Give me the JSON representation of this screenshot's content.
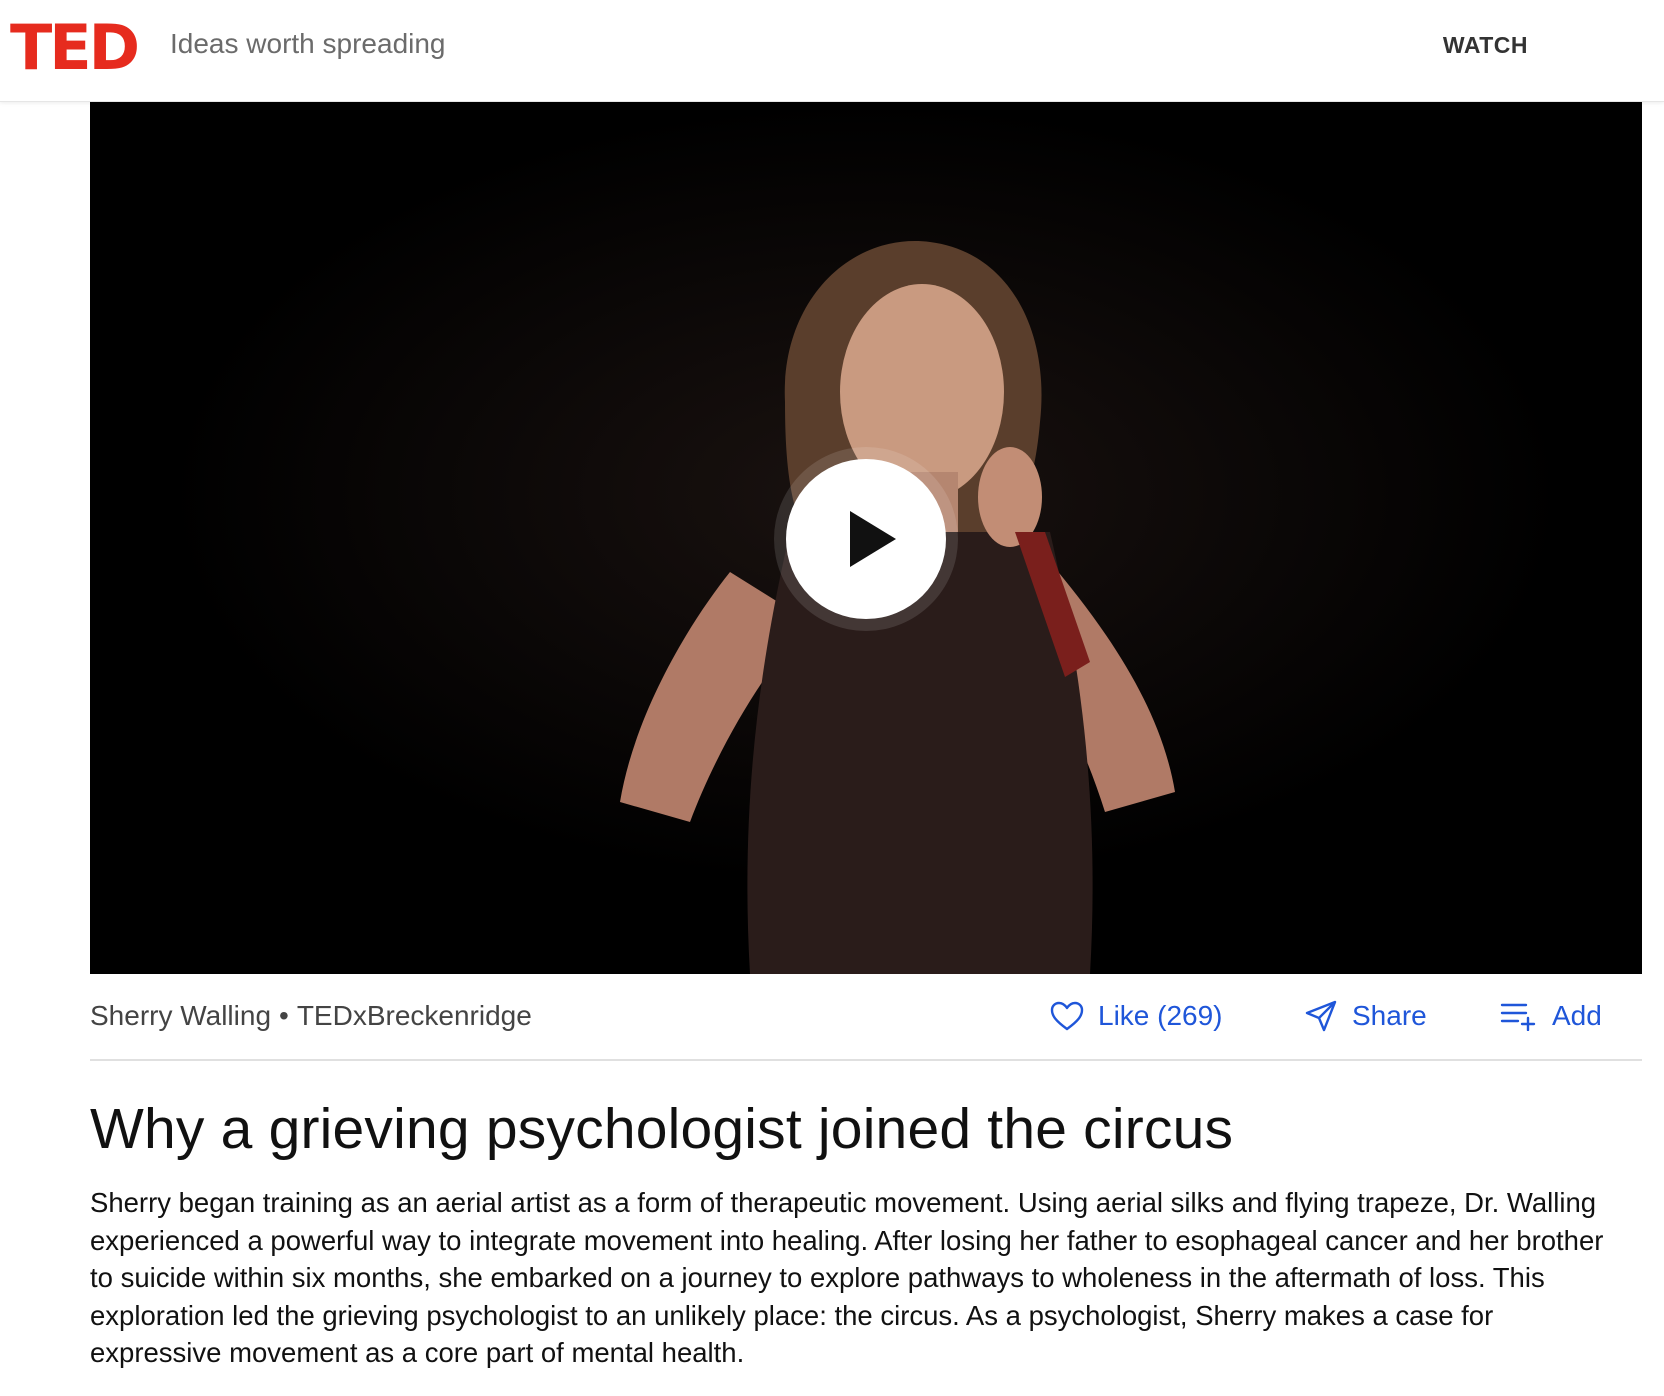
{
  "header": {
    "logo_text": "TED",
    "tagline": "Ideas worth spreading",
    "nav_watch": "WATCH"
  },
  "video": {
    "play_icon": "play-icon"
  },
  "talk": {
    "speaker": "Sherry Walling",
    "separator": "•",
    "event": "TEDxBreckenridge",
    "title": "Why a grieving psychologist joined the circus",
    "description": "Sherry began training as an aerial artist as a form of therapeutic movement. Using aerial silks and flying trapeze, Dr. Walling experienced a powerful way to integrate movement into healing. After losing her father to esophageal cancer and her brother to suicide within six months, she embarked on a journey to explore pathways to wholeness in the aftermath of loss. This exploration led the grieving psychologist to an unlikely place: the circus. As a psychologist, Sherry makes a case for expressive movement as a core part of mental health."
  },
  "actions": {
    "like_label": "Like (269)",
    "share_label": "Share",
    "add_label": "Add"
  },
  "colors": {
    "brand_red": "#e62b1e",
    "link_blue": "#1f56d9"
  }
}
